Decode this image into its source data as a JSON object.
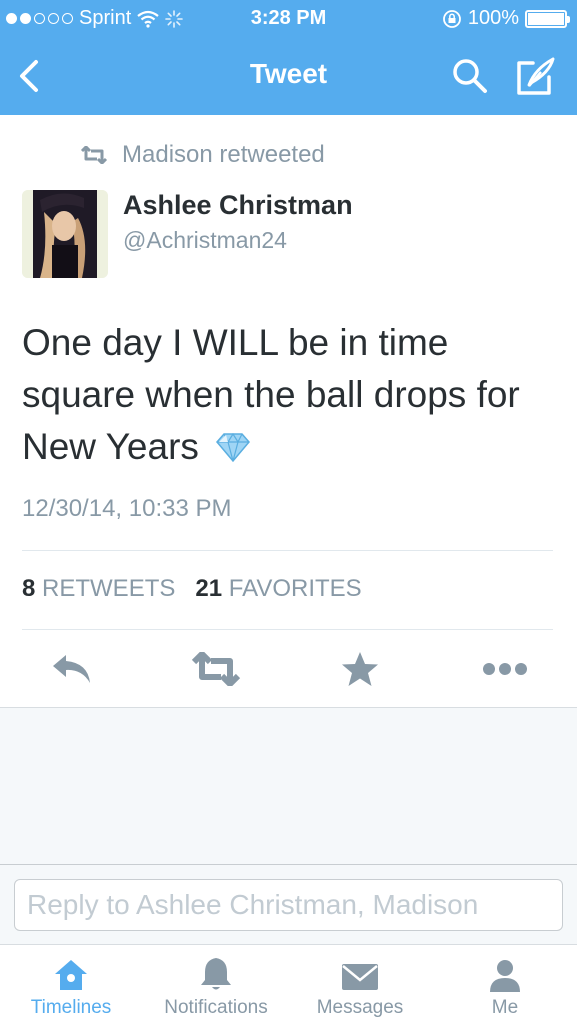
{
  "status_bar": {
    "carrier": "Sprint",
    "time": "3:28 PM",
    "battery": "100%"
  },
  "nav": {
    "title": "Tweet"
  },
  "tweet": {
    "retweeted_by": "Madison retweeted",
    "author_name": "Ashlee Christman",
    "author_handle": "@Achristman24",
    "text": "One day I WILL be in time square when the ball drops for New Years",
    "timestamp": "12/30/14, 10:33 PM",
    "retweets_count": "8",
    "retweets_label": "RETWEETS",
    "favorites_count": "21",
    "favorites_label": "FAVORITES"
  },
  "reply": {
    "placeholder": "Reply to Ashlee Christman, Madison"
  },
  "tabs": [
    {
      "label": "Timelines",
      "icon": "home-icon",
      "active": true
    },
    {
      "label": "Notifications",
      "icon": "bell-icon",
      "active": false
    },
    {
      "label": "Messages",
      "icon": "envelope-icon",
      "active": false
    },
    {
      "label": "Me",
      "icon": "person-icon",
      "active": false
    }
  ],
  "colors": {
    "brand": "#55acee",
    "text": "#292f33",
    "muted": "#8899a6"
  }
}
